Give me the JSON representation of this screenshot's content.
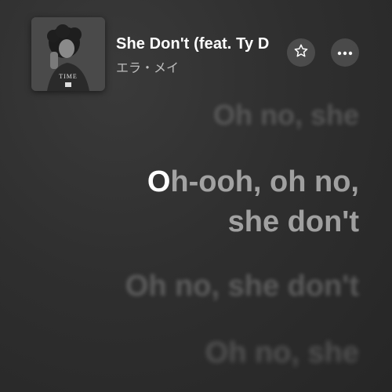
{
  "now_playing": {
    "title": "She Don't (feat. Ty D",
    "artist": "エラ・メイ",
    "artwork_label": "TIME",
    "artwork_icon": "album-artwork"
  },
  "controls": {
    "favorite_icon": "star-outline-icon",
    "more_icon": "ellipsis-icon"
  },
  "lyrics": {
    "previous": "Oh no, she",
    "current_highlight": "O",
    "current_line_1_rest": "h-ooh, oh no,",
    "current_line_2": "she don't",
    "next_1": "Oh no, she don't",
    "next_2": "Oh no, she"
  }
}
